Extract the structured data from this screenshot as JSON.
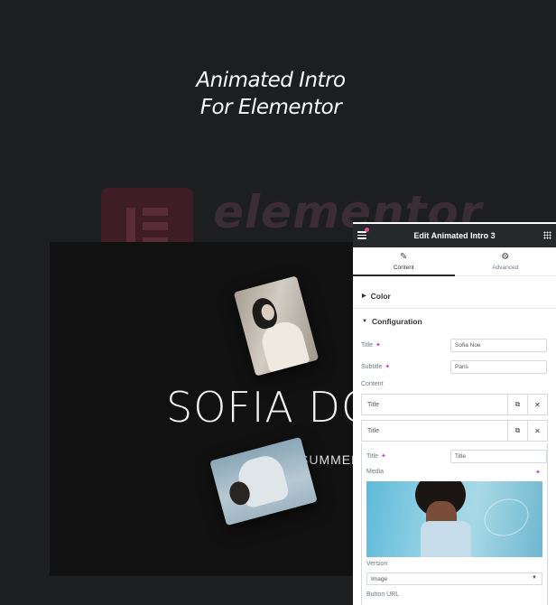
{
  "hero": {
    "line1": "Animated Intro",
    "line2": "For Elementor"
  },
  "background_logo": {
    "word": "elementor"
  },
  "preview": {
    "title": "SOFIA DO",
    "subtitle": "SUMMER"
  },
  "panel": {
    "title": "Edit Animated Intro 3",
    "tabs": [
      {
        "label": "Content",
        "icon": "pencil-icon"
      },
      {
        "label": "Advanced",
        "icon": "gear-icon"
      }
    ],
    "sections": {
      "color": "Color",
      "configuration": "Configuration"
    },
    "fields": {
      "title_label": "Title",
      "title_value": "Sofia Noe",
      "subtitle_label": "Subtitle",
      "subtitle_value": "Paris",
      "content_label": "Content"
    },
    "repeater_items": [
      {
        "label": "Title"
      },
      {
        "label": "Title"
      }
    ],
    "item": {
      "title_label": "Title",
      "title_value": "Title",
      "media_label": "Media",
      "version_label": "Version",
      "version_value": "Image",
      "button_url_label": "Button URL"
    },
    "colors": {
      "header": "#26292c",
      "accent": "#c036c7",
      "notification": "#e2498a"
    }
  }
}
